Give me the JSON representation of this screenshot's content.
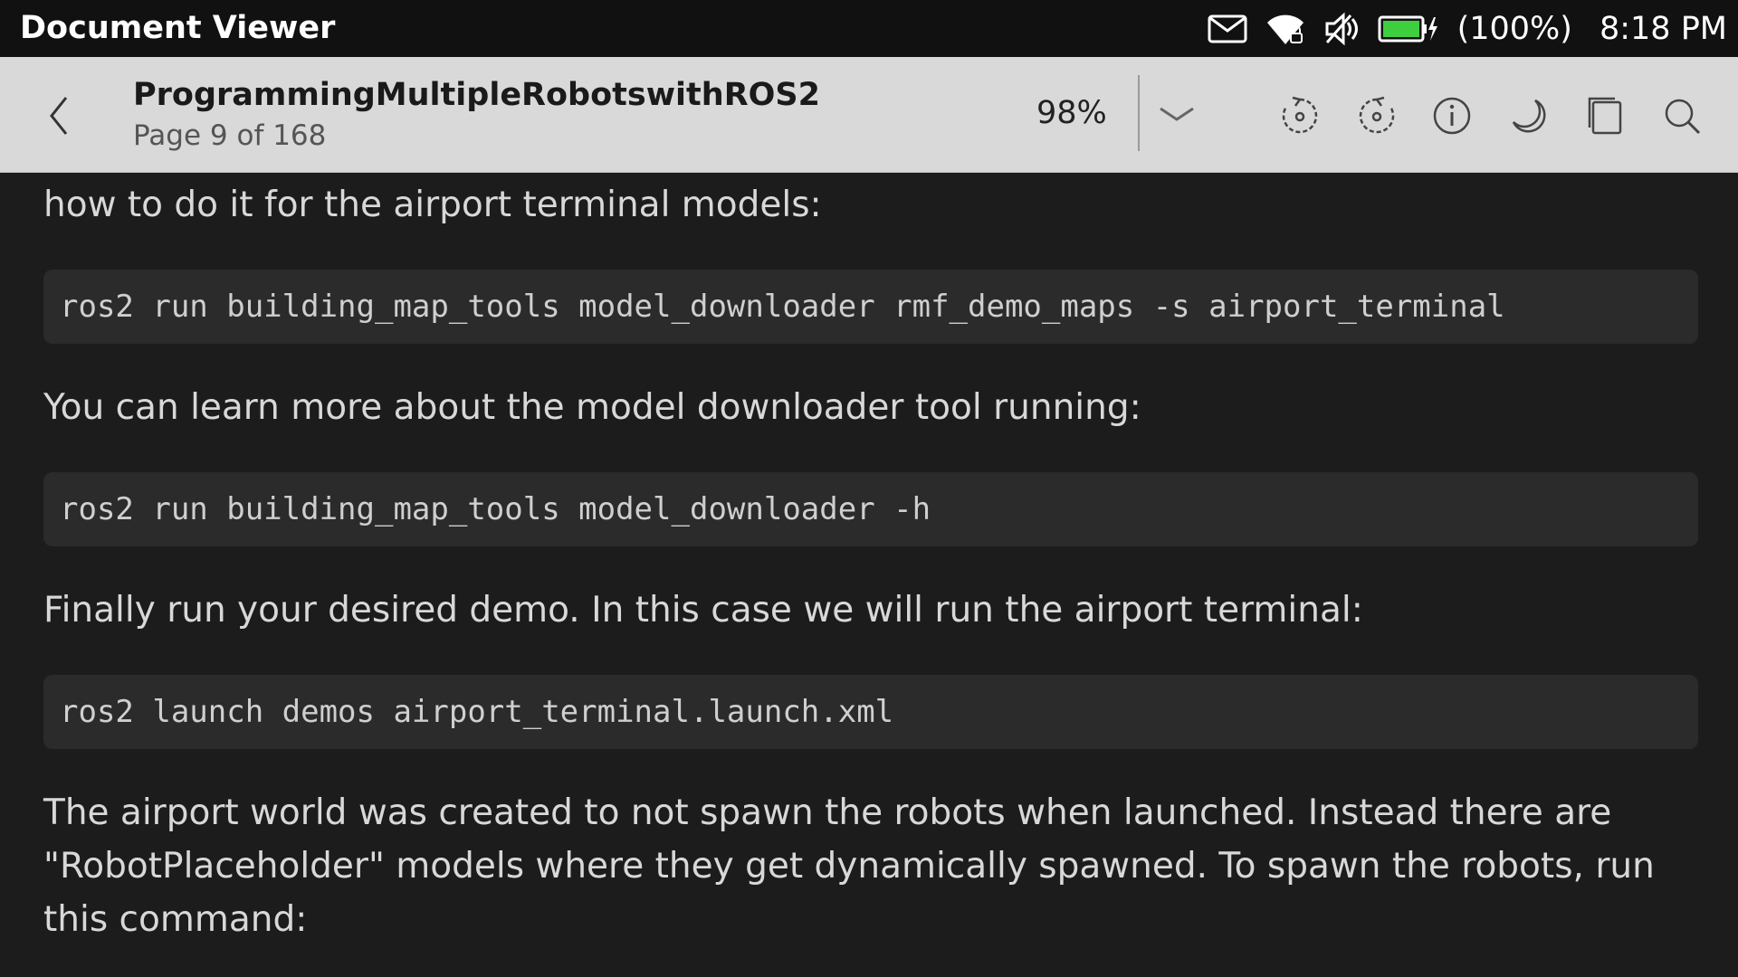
{
  "status_bar": {
    "app_title": "Document Viewer",
    "battery_text": "(100%)",
    "time": "8:18 PM",
    "icons": [
      "mail-icon",
      "wifi-icon",
      "speaker-muted-icon",
      "battery-charging-icon"
    ]
  },
  "toolbar": {
    "title": "ProgrammingMultipleRobotswithROS2",
    "page_info": "Page 9 of 168",
    "zoom": "98%",
    "buttons": [
      "back-icon",
      "zoom-dropdown-icon",
      "rotate-left-icon",
      "rotate-right-icon",
      "info-icon",
      "night-mode-icon",
      "page-view-icon",
      "search-icon"
    ]
  },
  "content": {
    "para1": "how to do it for the airport terminal models:",
    "code1": "ros2 run building_map_tools model_downloader rmf_demo_maps -s airport_terminal",
    "para2": "You can learn more about the model downloader tool running:",
    "code2": "ros2 run building_map_tools model_downloader -h",
    "para3": "Finally run your desired demo. In this case we will run the airport terminal:",
    "code3": "ros2 launch demos airport_terminal.launch.xml",
    "para4_line1": "The airport world was created to not spawn the robots when launched. Instead there are",
    "para4_line2": "\"RobotPlaceholder\" models where they get dynamically spawned. To spawn the robots, run",
    "para4_line3": "this command:"
  },
  "colors": {
    "background": "#1c1c1c",
    "toolbar": "#d9d9d9",
    "status_bar": "#111111",
    "code_bg": "#2b2b2b",
    "battery": "#3ecf3e"
  }
}
